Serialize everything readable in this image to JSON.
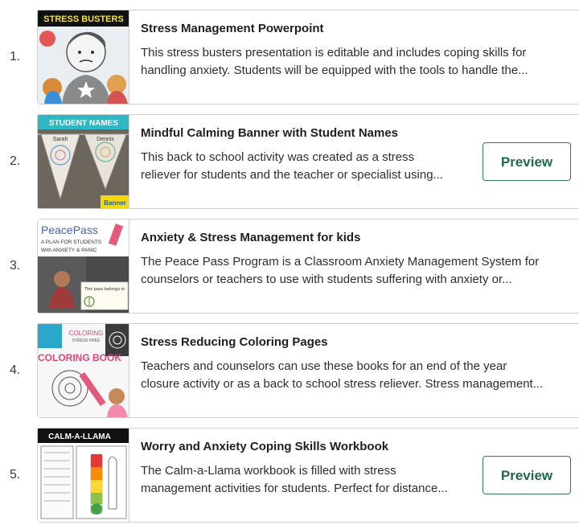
{
  "products": [
    {
      "number": "1.",
      "title": "Stress Management Powerpoint",
      "description_lines": [
        "This stress busters presentation is editable and includes coping skills for",
        "handling anxiety. Students will be equipped with the tools to handle the..."
      ],
      "thumbnail_text": [
        "STRESS BUSTERS"
      ],
      "has_preview": false
    },
    {
      "number": "2.",
      "title": "Mindful Calming Banner with Student Names",
      "description_lines": [
        "This back to school activity was created as a stress",
        "reliever for students and the teacher or specialist using..."
      ],
      "thumbnail_text": [
        "STUDENT NAMES",
        "Sarah",
        "Dennis",
        "Banner"
      ],
      "has_preview": true,
      "preview_label": "Preview"
    },
    {
      "number": "3.",
      "title": "Anxiety & Stress Management for kids",
      "description_lines": [
        "The Peace Pass Program is a Classroom Anxiety Management System for",
        "counselors or teachers to use with students suffering with anxiety or..."
      ],
      "thumbnail_text": [
        "PeacePass",
        "A PLAN FOR STUDENTS",
        "With ANXIETY & PANIC",
        "This pass belongs to"
      ],
      "has_preview": false
    },
    {
      "number": "4.",
      "title": "Stress Reducing Coloring Pages",
      "description_lines": [
        "Teachers and counselors can use these books for an end of the year",
        "closure activity or as a back to school stress reliever. Stress management..."
      ],
      "thumbnail_text": [
        "COLORING",
        "STRESS FREE",
        "COLORING BOOK"
      ],
      "has_preview": false
    },
    {
      "number": "5.",
      "title": "Worry and Anxiety Coping Skills Workbook",
      "description_lines": [
        "The Calm-a-Llama workbook is filled with stress",
        "management activities for students. Perfect for distance..."
      ],
      "thumbnail_text": [
        "CALM-A-LLAMA"
      ],
      "has_preview": true,
      "preview_label": "Preview"
    }
  ],
  "colors": {
    "preview_border": "#2e7d59",
    "preview_text": "#236a48",
    "card_border": "#cfcfcf"
  }
}
